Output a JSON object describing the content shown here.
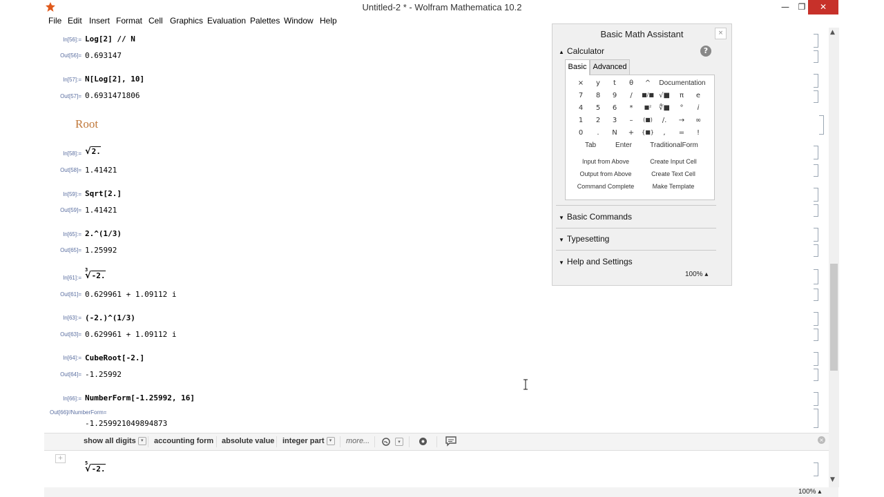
{
  "window": {
    "title": "Untitled-2 * - Wolfram Mathematica 10.2",
    "min_glyph": "—",
    "restore_glyph": "❐",
    "close_glyph": "✕"
  },
  "menu": [
    "File",
    "Edit",
    "Insert",
    "Format",
    "Cell",
    "Graphics",
    "Evaluation",
    "Palettes",
    "Window",
    "Help"
  ],
  "cells": [
    {
      "in_label": "In[56]:=",
      "input": "Log[2] // N",
      "out_label": "Out[56]=",
      "output": "0.693147"
    },
    {
      "in_label": "In[57]:=",
      "input": "N[Log[2], 10]",
      "out_label": "Out[57]=",
      "output": "0.6931471806"
    },
    {
      "in_label": "In[58]:=",
      "input": "2.",
      "out_label": "Out[58]=",
      "output": "1.41421"
    },
    {
      "in_label": "In[59]:=",
      "input": "Sqrt[2.]",
      "out_label": "Out[59]=",
      "output": "1.41421"
    },
    {
      "in_label": "In[65]:=",
      "input": "2.^(1/3)",
      "out_label": "Out[65]=",
      "output": "1.25992"
    },
    {
      "in_label": "In[61]:=",
      "input": "-2.",
      "input_index": "3",
      "out_label": "Out[61]=",
      "output": "0.629961 + 1.09112 i"
    },
    {
      "in_label": "In[63]:=",
      "input": "(-2.)^(1/3)",
      "out_label": "Out[63]=",
      "output": "0.629961 + 1.09112 i"
    },
    {
      "in_label": "In[64]:=",
      "input": "CubeRoot[-2.]",
      "out_label": "Out[64]=",
      "output": "-1.25992"
    },
    {
      "in_label": "In[66]:=",
      "input": "NumberForm[-1.25992, 16]",
      "out_label": "Out[66]//NumberForm=",
      "output": "-1.259921049894873"
    }
  ],
  "section": "Root",
  "new_input": {
    "index": "5",
    "radicand": "-2."
  },
  "suggestions": {
    "items": [
      "show all digits",
      "accounting form",
      "absolute value",
      "integer part",
      "more..."
    ],
    "dropdown_glyph": "▾"
  },
  "status": {
    "zoom": "100%"
  },
  "palette": {
    "title": "Basic Math Assistant",
    "close_glyph": "×",
    "calculator_label": "Calculator",
    "help_glyph": "?",
    "tabs": [
      "Basic",
      "Advanced"
    ],
    "keys": [
      [
        "×",
        "y",
        "t",
        "θ",
        "^"
      ],
      [
        "7",
        "8",
        "9",
        "/",
        "■/■",
        "√■",
        "π",
        "e"
      ],
      [
        "4",
        "5",
        "6",
        "*",
        "■²",
        "∜■",
        "°",
        "i"
      ],
      [
        "1",
        "2",
        "3",
        "–",
        "(■)",
        "/.",
        "→",
        "∞"
      ],
      [
        "0",
        ".",
        "N",
        "+",
        "{■}",
        ",",
        "=",
        "!"
      ]
    ],
    "documentation": "Documentation",
    "wide_keys": [
      "Tab",
      "Enter",
      "TraditionalForm"
    ],
    "commands": [
      "Input from Above",
      "Create Input Cell",
      "Output from Above",
      "Create Text Cell",
      "Command Complete",
      "Make Template"
    ],
    "sections": [
      "Basic Commands",
      "Typesetting",
      "Help and Settings"
    ],
    "zoom": "100%"
  }
}
